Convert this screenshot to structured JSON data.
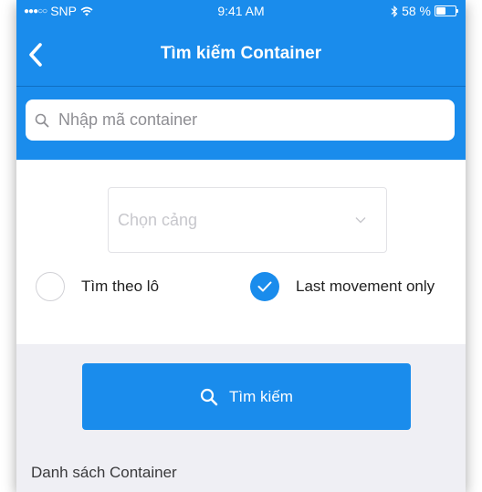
{
  "status_bar": {
    "carrier": "SNP",
    "time": "9:41 AM",
    "battery_percent": "58 %",
    "battery_level": 0.58
  },
  "nav": {
    "title": "Tìm kiếm Container",
    "back_icon": "chevron-left-icon"
  },
  "search": {
    "placeholder": "Nhập mã container",
    "value": "",
    "icon": "search-icon"
  },
  "port_select": {
    "placeholder": "Chọn cảng",
    "icon": "chevron-down-icon"
  },
  "options": [
    {
      "label": "Tìm theo lô",
      "checked": false
    },
    {
      "label": "Last movement only",
      "checked": true
    }
  ],
  "search_button": {
    "label": "Tìm kiếm",
    "icon": "search-icon"
  },
  "list": {
    "title": "Danh sách Container"
  },
  "colors": {
    "primary": "#1a8cec",
    "background": "#efeff4",
    "placeholder": "#c7c7cc"
  }
}
